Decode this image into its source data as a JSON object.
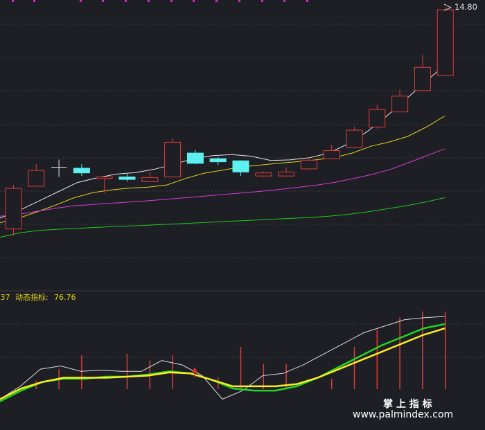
{
  "chart_data": [
    {
      "type": "candlestick",
      "price_high_label": "14.80",
      "ylim": [
        6.8,
        15.0
      ],
      "candles": [
        {
          "o": 7.65,
          "c": 8.96,
          "h": 9.07,
          "l": 7.44,
          "dir": "up"
        },
        {
          "o": 9.03,
          "c": 9.54,
          "h": 9.74,
          "l": 9.03,
          "dir": "up"
        },
        {
          "o": 9.64,
          "c": 9.64,
          "h": 9.89,
          "l": 9.33,
          "dir": "flat"
        },
        {
          "o": 9.61,
          "c": 9.46,
          "h": 9.74,
          "l": 9.36,
          "dir": "down"
        },
        {
          "o": 9.28,
          "c": 9.33,
          "h": 9.33,
          "l": 8.81,
          "dir": "up"
        },
        {
          "o": 9.33,
          "c": 9.25,
          "h": 9.43,
          "l": 9.18,
          "dir": "down"
        },
        {
          "o": 9.18,
          "c": 9.31,
          "h": 9.49,
          "l": 9.18,
          "dir": "up"
        },
        {
          "o": 9.33,
          "c": 10.45,
          "h": 10.58,
          "l": 9.33,
          "dir": "up"
        },
        {
          "o": 10.1,
          "c": 9.77,
          "h": 10.2,
          "l": 9.74,
          "dir": "down"
        },
        {
          "o": 9.92,
          "c": 9.82,
          "h": 9.97,
          "l": 9.72,
          "dir": "down"
        },
        {
          "o": 9.85,
          "c": 9.49,
          "h": 9.87,
          "l": 9.36,
          "dir": "down"
        },
        {
          "o": 9.36,
          "c": 9.46,
          "h": 9.51,
          "l": 9.33,
          "dir": "up"
        },
        {
          "o": 9.36,
          "c": 9.49,
          "h": 9.64,
          "l": 9.33,
          "dir": "up"
        },
        {
          "o": 9.59,
          "c": 9.87,
          "h": 9.97,
          "l": 9.56,
          "dir": "up"
        },
        {
          "o": 9.92,
          "c": 10.18,
          "h": 10.36,
          "l": 9.92,
          "dir": "up"
        },
        {
          "o": 10.28,
          "c": 10.84,
          "h": 10.94,
          "l": 10.28,
          "dir": "up"
        },
        {
          "o": 10.94,
          "c": 11.51,
          "h": 11.66,
          "l": 10.89,
          "dir": "up"
        },
        {
          "o": 11.43,
          "c": 11.94,
          "h": 12.15,
          "l": 11.43,
          "dir": "up"
        },
        {
          "o": 12.12,
          "c": 12.87,
          "h": 13.28,
          "l": 12.12,
          "dir": "up"
        },
        {
          "o": 12.61,
          "c": 14.73,
          "h": 14.8,
          "l": 12.61,
          "dir": "up"
        }
      ],
      "moving_averages": [
        {
          "name": "white",
          "color": "#e8e8e8",
          "values": [
            8.0,
            8.25,
            8.55,
            8.85,
            9.15,
            9.3,
            9.42,
            9.47,
            9.58,
            9.74,
            9.92,
            10.02,
            10.05,
            10.0,
            9.86,
            9.88,
            9.95,
            10.1,
            10.4,
            10.8,
            11.3,
            11.85,
            12.4,
            12.95
          ]
        },
        {
          "name": "yellow",
          "color": "#e6d21a",
          "values": [
            7.85,
            8.0,
            8.2,
            8.42,
            8.66,
            8.82,
            8.91,
            8.97,
            9.0,
            9.07,
            9.28,
            9.45,
            9.55,
            9.65,
            9.71,
            9.77,
            9.82,
            9.88,
            9.95,
            10.1,
            10.32,
            10.46,
            10.64,
            10.94,
            11.3
          ]
        },
        {
          "name": "magenta",
          "color": "#d83ad8",
          "values": [
            8.06,
            8.12,
            8.22,
            8.32,
            8.4,
            8.44,
            8.48,
            8.52,
            8.56,
            8.61,
            8.66,
            8.71,
            8.76,
            8.81,
            8.86,
            8.92,
            8.99,
            9.06,
            9.15,
            9.27,
            9.4,
            9.56,
            9.78,
            10.01,
            10.24
          ]
        },
        {
          "name": "green",
          "color": "#1ec81e",
          "values": [
            7.38,
            7.52,
            7.6,
            7.64,
            7.67,
            7.7,
            7.73,
            7.75,
            7.78,
            7.81,
            7.84,
            7.87,
            7.9,
            7.93,
            7.96,
            7.99,
            8.02,
            8.06,
            8.12,
            8.2,
            8.3,
            8.4,
            8.52,
            8.66
          ]
        }
      ],
      "top_marks_color": "#d22ad2",
      "grid": "horizontal dashed"
    },
    {
      "type": "line",
      "indicator_label": "动态指标:",
      "indicator_value": "76.76",
      "left_clipped_value": ".37",
      "ylim": [
        0,
        100
      ],
      "bars": [
        0,
        10,
        24,
        40,
        0,
        42,
        34,
        40,
        0,
        14,
        50,
        30,
        30,
        0,
        12,
        50,
        70,
        85,
        92,
        92
      ],
      "series": [
        {
          "name": "white",
          "color": "#dcdcdc",
          "values": [
            10,
            22,
            38,
            41,
            36,
            37,
            36,
            36,
            46,
            42,
            32,
            10,
            18,
            32,
            34,
            42,
            52,
            62,
            72,
            78,
            84,
            86,
            87
          ]
        },
        {
          "name": "green",
          "color": "#22d622",
          "values": [
            8,
            18,
            26,
            29,
            29,
            31,
            31,
            33,
            36,
            34,
            28,
            20,
            18,
            18,
            22,
            30,
            40,
            50,
            60,
            68,
            76,
            80
          ]
        },
        {
          "name": "yellow",
          "color": "#ffee22",
          "values": [
            10,
            20,
            26,
            30,
            30,
            30,
            31,
            32,
            35,
            34,
            28,
            22,
            22,
            22,
            24,
            30,
            38,
            46,
            54,
            62,
            70,
            76
          ]
        }
      ],
      "signal_arrow_color": "#e03030",
      "watermark_line1": "掌 上 指 标",
      "watermark_line2": "www.palmindex.com"
    }
  ]
}
